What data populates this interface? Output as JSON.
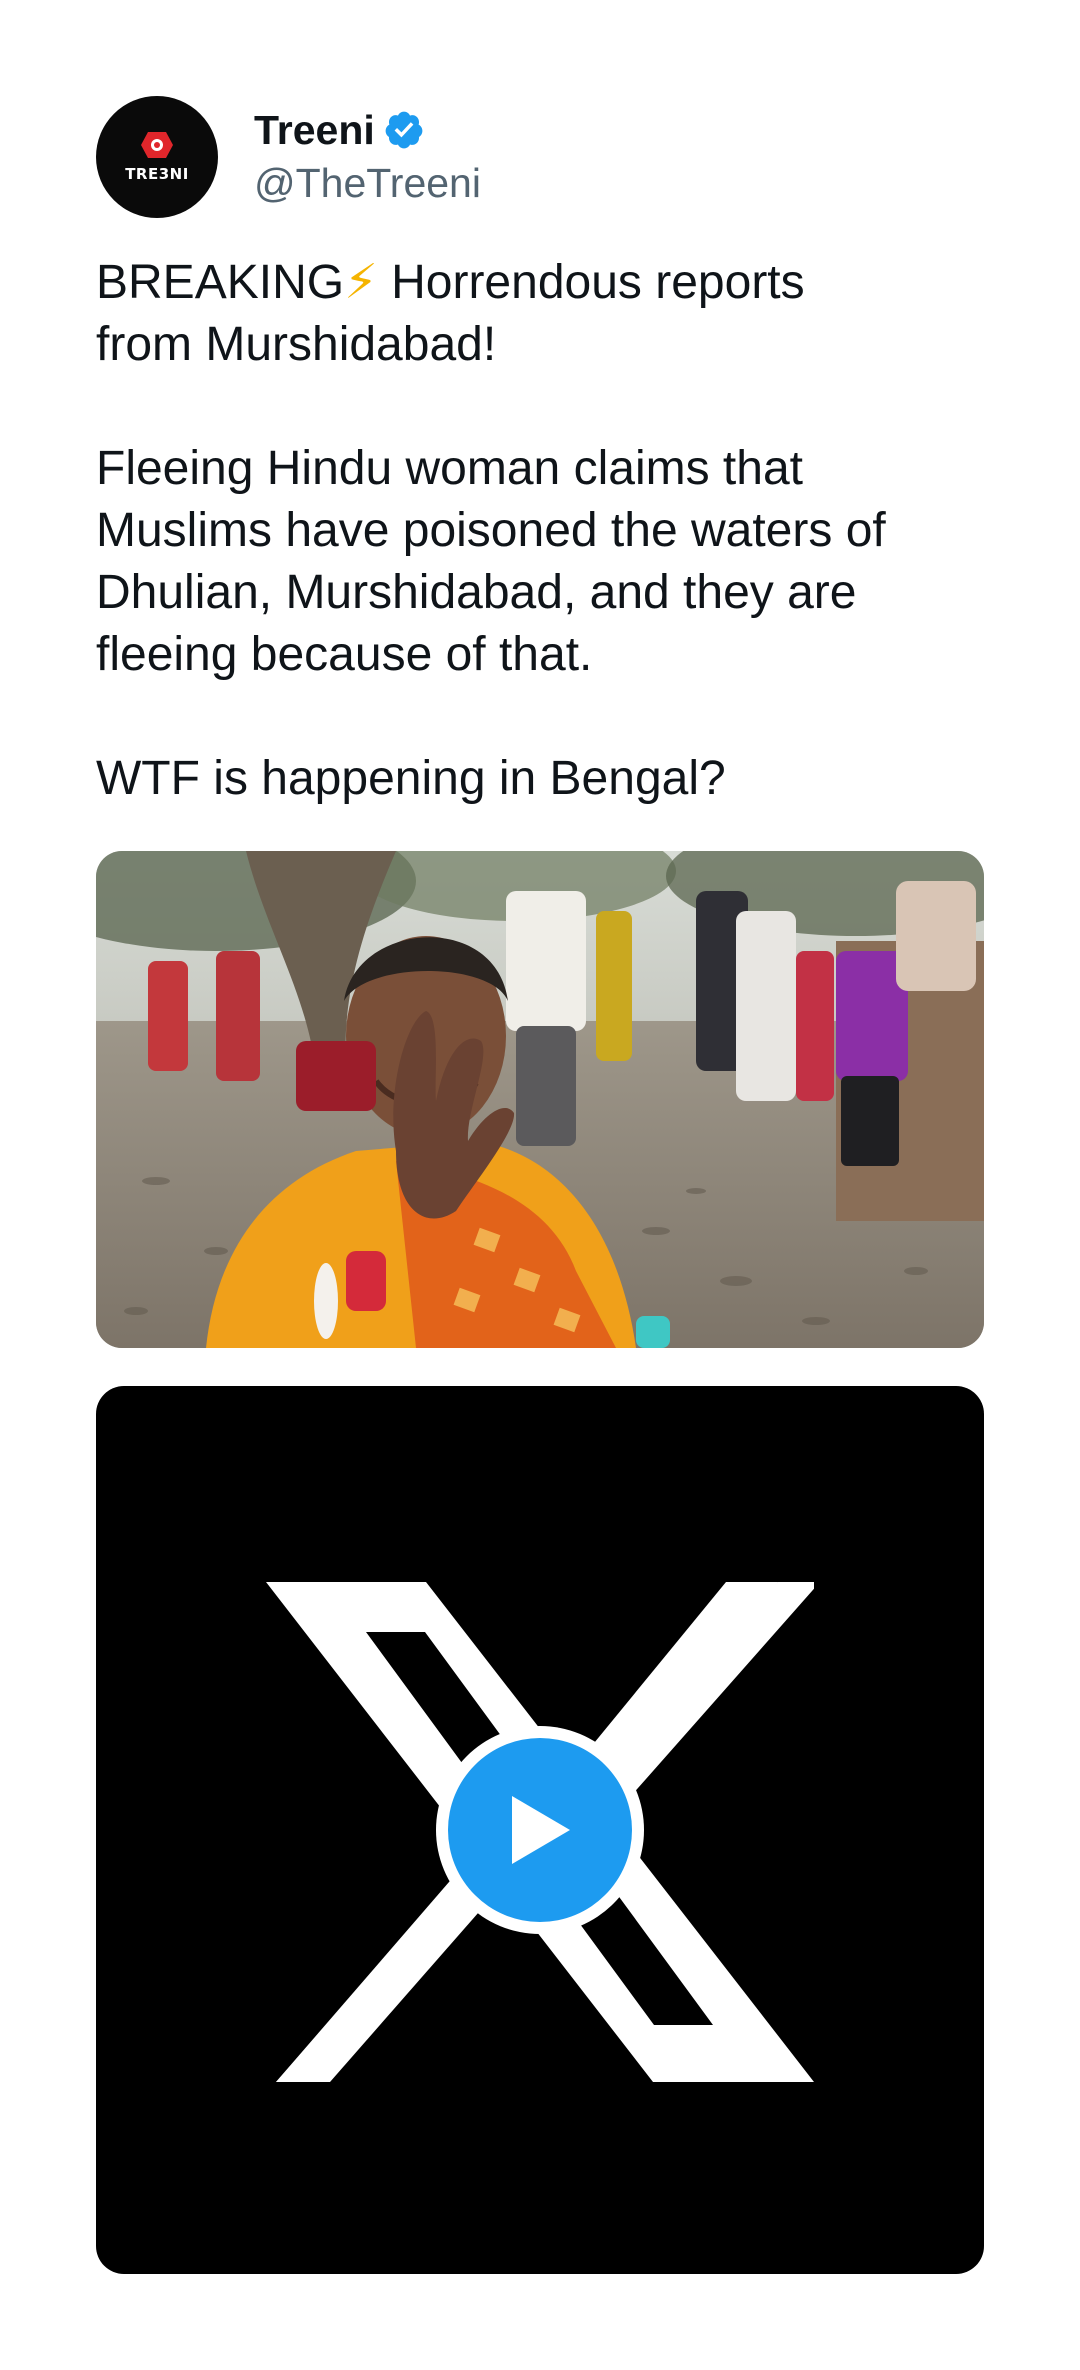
{
  "author": {
    "display_name": "Treeni",
    "handle": "@TheTreeni",
    "verified": true,
    "avatar_text": "TRE3NI",
    "avatar_icon": "treeni-logo-icon"
  },
  "tweet": {
    "line1_prefix": "BREAKING",
    "bolt": "⚡",
    "line1_rest": " Horrendous reports\nfrom Murshidabad!\n\nFleeing Hindu woman claims that\nMuslims have poisoned the waters of\nDhulian, Murshidabad, and they are\nfleeing because of that.\n\nWTF is happening in Bengal?"
  },
  "media": [
    {
      "type": "photo"
    },
    {
      "type": "video",
      "overlay_icon": "x-logo-icon",
      "control_icon": "play-icon"
    }
  ],
  "colors": {
    "text": "#0f1419",
    "secondary_text": "#536471",
    "verified_blue": "#1d9bf0",
    "bolt_yellow": "#f5b400",
    "video_bg": "#000000"
  }
}
